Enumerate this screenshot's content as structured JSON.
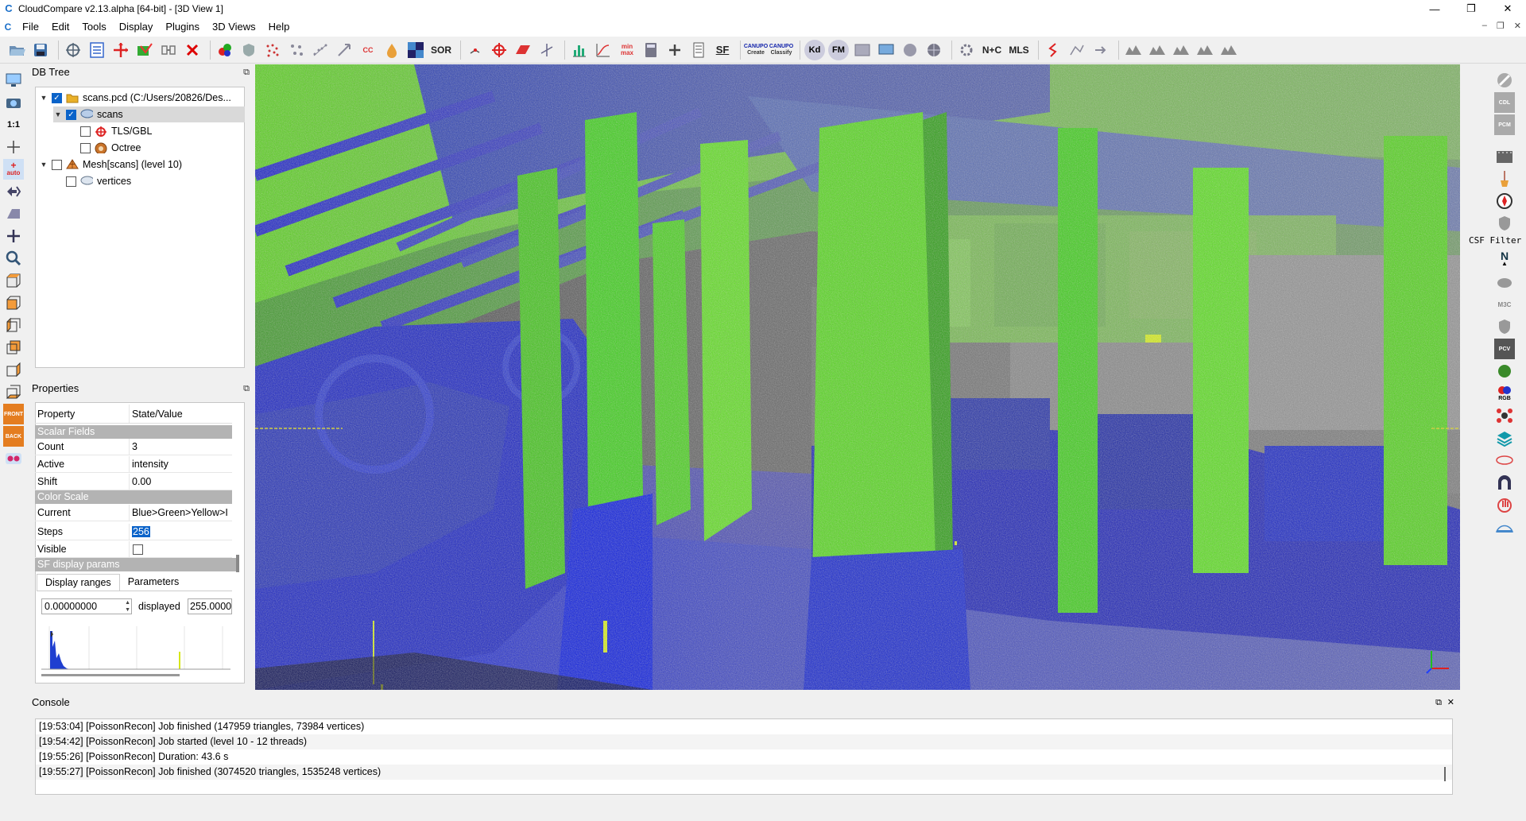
{
  "window": {
    "title": "CloudCompare v2.13.alpha [64-bit] - [3D View 1]",
    "minimize": "—",
    "maximize": "❐",
    "close": "✕"
  },
  "menu": {
    "items": [
      "File",
      "Edit",
      "Tools",
      "Display",
      "Plugins",
      "3D Views",
      "Help"
    ]
  },
  "toolbar": {
    "sor_label": "SOR",
    "sf_label": "SF",
    "kd_label": "Kd",
    "fm_label": "FM",
    "nc_label": "N+C",
    "mls_label": "MLS",
    "canupo_create": "Create",
    "canupo_classify": "Classify"
  },
  "left_toolbar": {
    "one_to_one": "1:1",
    "auto": "auto",
    "front": "FRONT",
    "back": "BACK"
  },
  "db_tree": {
    "title": "DB Tree",
    "nodes": [
      {
        "label": "scans.pcd (C:/Users/20826/Des..."
      },
      {
        "label": "scans"
      },
      {
        "label": "TLS/GBL"
      },
      {
        "label": "Octree"
      },
      {
        "label": "Mesh[scans] (level 10)"
      },
      {
        "label": "vertices"
      }
    ]
  },
  "properties": {
    "title": "Properties",
    "col_property": "Property",
    "col_value": "State/Value",
    "section_scalar": "Scalar Fields",
    "count_label": "Count",
    "count_value": "3",
    "active_label": "Active",
    "active_value": "intensity",
    "shift_label": "Shift",
    "shift_value": "0.00",
    "section_color": "Color Scale",
    "current_label": "Current",
    "current_value": "Blue>Green>Yellow>I",
    "steps_label": "Steps",
    "steps_value": "256",
    "visible_label": "Visible",
    "section_sf": "SF display params",
    "tab_ranges": "Display ranges",
    "tab_params": "Parameters",
    "range_min": "0.00000000",
    "displayed_label": "displayed",
    "range_max": "255.0000"
  },
  "right_toolbar": {
    "csf_label": "CSF Filter",
    "n_label": "N",
    "rgb_label": "RGB"
  },
  "console": {
    "title": "Console",
    "lines": [
      "[19:53:04] [PoissonRecon] Job finished (147959 triangles, 73984 vertices)",
      "[19:54:42] [PoissonRecon] Job started (level 10 - 12 threads)",
      "[19:55:26] [PoissonRecon] Duration: 43.6 s",
      "[19:55:27] [PoissonRecon] Job finished (3074520 triangles, 1535248 vertices)"
    ]
  },
  "colors": {
    "accent": "#0b63c9",
    "cloud_blue": "#0a17d6",
    "cloud_green": "#59e01a",
    "cloud_yellow": "#c8f01e"
  }
}
